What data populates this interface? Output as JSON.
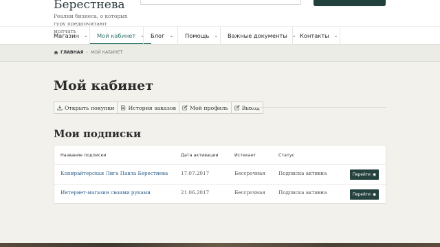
{
  "site": {
    "title": "Берестнева",
    "tagline": "Реалии бизнеса, о которых гуру предпочитают молчать"
  },
  "nav": {
    "items": [
      {
        "label": "Магазин",
        "active": false
      },
      {
        "label": "Мой кабинет",
        "active": true
      },
      {
        "label": "Блог",
        "active": false
      },
      {
        "label": "Помощь",
        "active": false
      },
      {
        "label": "Важные документы",
        "active": false
      },
      {
        "label": "Контакты",
        "active": false
      }
    ]
  },
  "breadcrumb": {
    "home": "ГЛАВНАЯ",
    "current": "МОЙ КАБИНЕТ"
  },
  "page": {
    "title": "Мой кабинет"
  },
  "tabs": [
    {
      "label": "Открыть покупки",
      "icon": "download-icon"
    },
    {
      "label": "История заказов",
      "icon": "document-icon"
    },
    {
      "label": "Мой профиль",
      "icon": "edit-icon"
    },
    {
      "label": "Выход",
      "icon": "edit-icon"
    }
  ],
  "subscriptions": {
    "title": "Мои подписки",
    "columns": {
      "name": "Название подписки",
      "activated": "Дата активации",
      "expires": "Истекает",
      "status": "Статус"
    },
    "rows": [
      {
        "name": "Копирайтерская Лига Павла Берестнева",
        "activated": "17.07.2017",
        "expires": "Бессрочная",
        "status": "Подписка активна",
        "action": "Перейти"
      },
      {
        "name": "Интернет-магазин своими руками",
        "activated": "21.06.2017",
        "expires": "Бессрочная",
        "status": "Подписка активна",
        "action": "Перейти"
      }
    ]
  },
  "colors": {
    "accent": "#2c6f6a",
    "button": "#26423f",
    "link": "#2d5f8a",
    "background": "#f2f1ec"
  }
}
